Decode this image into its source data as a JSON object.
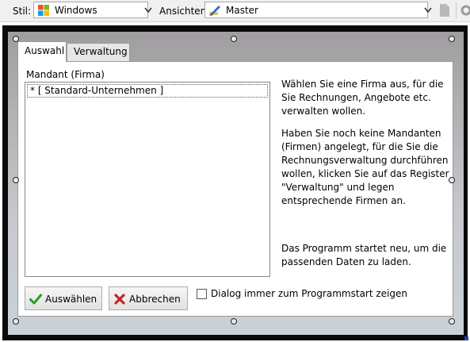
{
  "toolbar": {
    "style_label": "Stil:",
    "style_value": "Windows",
    "style_icon": "windows-logo-icon",
    "views_label": "Ansichten:",
    "views_value": "Master",
    "views_icon": "pen-edit-icon"
  },
  "dialog": {
    "tabs": [
      {
        "label": "Auswahl",
        "active": true
      },
      {
        "label": "Verwaltung",
        "active": false
      }
    ],
    "group_label": "Mandant (Firma)",
    "list_items": [
      "* [ Standard-Unternehmen ]"
    ],
    "info_text_1": "Wählen Sie eine Firma aus, für die Sie Rechnungen, Angebote etc. verwalten wollen.",
    "info_text_2": "Haben Sie noch keine Mandanten (Firmen) angelegt, für die Sie die Rechnungsverwaltung durchführen wollen, klicken Sie auf das Register \"Verwaltung\" und legen entsprechende Firmen an.",
    "info_text_3": "Das Programm startet neu, um die passenden Daten zu laden.",
    "select_button": "Auswählen",
    "cancel_button": "Abbrechen",
    "checkbox_label": "Dialog immer zum Programmstart zeigen",
    "checkbox_checked": false
  },
  "colors": {
    "select_icon": "#2a9d2a",
    "cancel_icon": "#c0262d",
    "selection_marker": "#1c3fbf"
  }
}
